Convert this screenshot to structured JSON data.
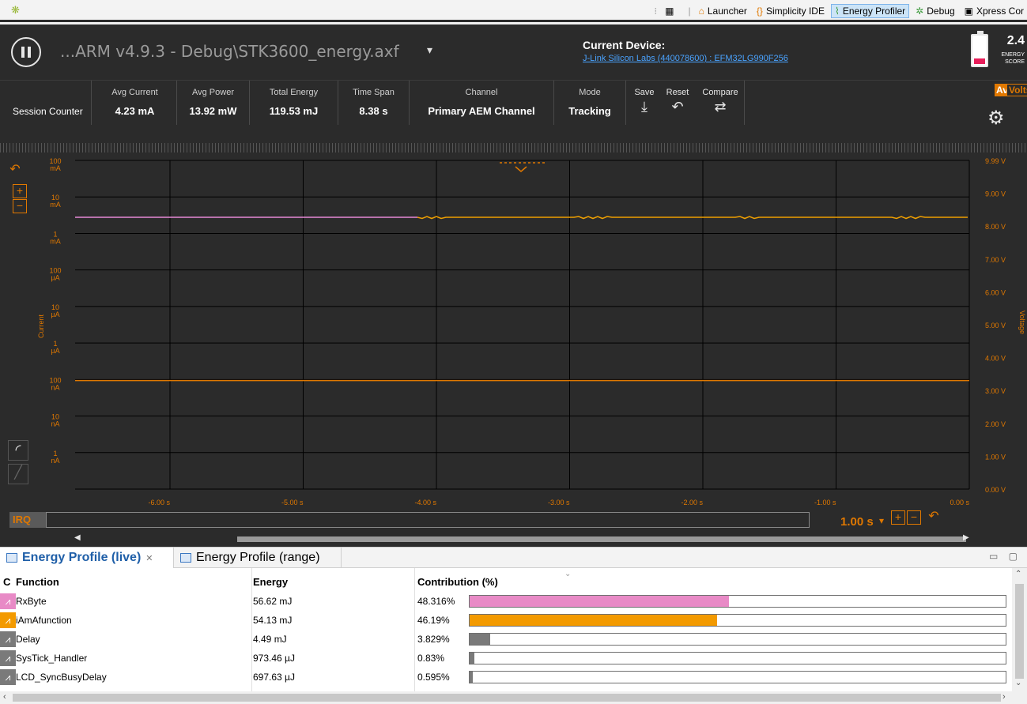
{
  "perspective_bar": {
    "items": [
      {
        "label": "Launcher",
        "icon": "launcher-icon",
        "active": false
      },
      {
        "label": "Simplicity IDE",
        "icon": "braces-icon",
        "active": false
      },
      {
        "label": "Energy Profiler",
        "icon": "energy-wave-icon",
        "active": true
      },
      {
        "label": "Debug",
        "icon": "bug-icon",
        "active": false
      },
      {
        "label": "Xpress Cor",
        "icon": "chip-icon",
        "active": false
      }
    ]
  },
  "header": {
    "file_title": "...ARM v4.9.3 - Debug\\STK3600_energy.axf",
    "dropdown_glyph": "▾",
    "current_device_label": "Current Device:",
    "current_device_link": "J-Link Silicon Labs (440078600) : EFM32LG990F256",
    "energy_score": "2.4",
    "energy_score_label_1": "ENERGY",
    "energy_score_label_2": "SCORE",
    "battery_level": 0.2,
    "colors": {
      "accent": "#e07800",
      "battery": "#e81e5a",
      "link": "#4aa3ff"
    }
  },
  "stats": {
    "session_counter": "Session Counter",
    "avg_current": {
      "label": "Avg Current",
      "value": "4.23 mA"
    },
    "avg_power": {
      "label": "Avg Power",
      "value": "13.92 mW"
    },
    "total_energy": {
      "label": "Total Energy",
      "value": "119.53 mJ"
    },
    "time_span": {
      "label": "Time Span",
      "value": "8.38 s"
    },
    "channel": {
      "label": "Channel",
      "value": "Primary AEM Channel"
    },
    "mode": {
      "label": "Mode",
      "value": "Tracking"
    },
    "save_label": "Save",
    "reset_label": "Reset",
    "compare_label": "Compare",
    "avg_toggle": "Avg",
    "volts_toggle": "Volts"
  },
  "plot": {
    "current_axis_title": "Current",
    "voltage_axis_title": "Voltage",
    "current_ticks": [
      {
        "v": "100",
        "u": "mA"
      },
      {
        "v": "10",
        "u": "mA"
      },
      {
        "v": "1",
        "u": "mA"
      },
      {
        "v": "100",
        "u": "µA"
      },
      {
        "v": "10",
        "u": "µA"
      },
      {
        "v": "1",
        "u": "µA"
      },
      {
        "v": "100",
        "u": "nA"
      },
      {
        "v": "10",
        "u": "nA"
      },
      {
        "v": "1",
        "u": "nA"
      }
    ],
    "voltage_ticks": [
      "9.99 V",
      "9.00 V",
      "8.00 V",
      "7.00 V",
      "6.00 V",
      "5.00 V",
      "4.00 V",
      "3.00 V",
      "2.00 V",
      "1.00 V",
      "0.00 V"
    ],
    "time_ticks": [
      "-6.00 s",
      "-5.00 s",
      "-4.00 s",
      "-3.00 s",
      "-2.00 s",
      "-1.00 s",
      "0.00 s"
    ],
    "colors": {
      "current_line": "#f0a000",
      "current_past": "#e88ad8",
      "voltage_line": "#e07800",
      "grid": "#000000",
      "bg": "#2b2b2b"
    }
  },
  "irq": {
    "label": "IRQ",
    "zoom_value": "1.00 s",
    "zoom_caret": "▾"
  },
  "bottom": {
    "tabs": [
      {
        "label": "Energy Profile (live)",
        "active": true
      },
      {
        "label": "Energy Profile (range)",
        "active": false
      }
    ],
    "columns": {
      "c": "C",
      "function": "Function",
      "energy": "Energy",
      "contribution": "Contribution (%)"
    },
    "rows": [
      {
        "function": "RxByte",
        "energy": "56.62 mJ",
        "percent": "48.316%",
        "fraction": 0.48316,
        "color": "#e88ac6"
      },
      {
        "function": "iAmAfunction",
        "energy": "54.13 mJ",
        "percent": "46.19%",
        "fraction": 0.4619,
        "color": "#f39a00"
      },
      {
        "function": "Delay",
        "energy": "4.49 mJ",
        "percent": "3.829%",
        "fraction": 0.03829,
        "color": "#7a7a7a"
      },
      {
        "function": "SysTick_Handler",
        "energy": "973.46 µJ",
        "percent": "0.83%",
        "fraction": 0.0083,
        "color": "#7a7a7a"
      },
      {
        "function": "LCD_SyncBusyDelay",
        "energy": "697.63 µJ",
        "percent": "0.595%",
        "fraction": 0.00595,
        "color": "#7a7a7a"
      }
    ]
  }
}
